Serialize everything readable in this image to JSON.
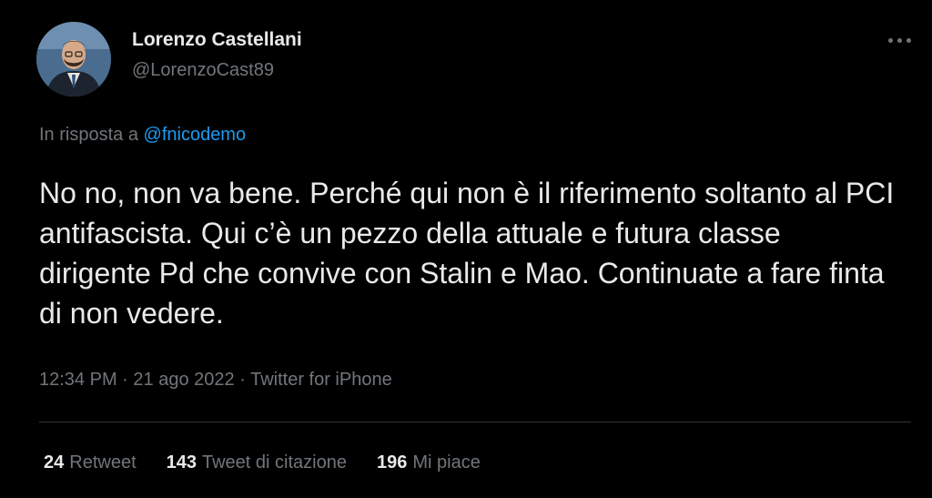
{
  "author": {
    "name": "Lorenzo Castellani",
    "handle": "@LorenzoCast89"
  },
  "reply": {
    "prefix": "In risposta a",
    "mention": "@fnicodemo"
  },
  "tweet": {
    "text": "No no, non va bene. Perché qui non è il riferimento soltanto al PCI antifascista. Qui c’è un pezzo della attuale e futura classe dirigente Pd che convive con Stalin e Mao. Continuate a fare finta di non vedere."
  },
  "meta": {
    "time": "12:34 PM",
    "separator": "·",
    "date": "21 ago 2022",
    "source": "Twitter for iPhone"
  },
  "stats": [
    {
      "count": "24",
      "label": "Retweet"
    },
    {
      "count": "143",
      "label": "Tweet di citazione"
    },
    {
      "count": "196",
      "label": "Mi piace"
    }
  ],
  "icons": {
    "more": "more-options-icon"
  },
  "colors": {
    "background": "#000000",
    "text": "#e7e9ea",
    "muted": "#71767b",
    "link": "#1d9bf0",
    "divider": "#2f3336"
  }
}
